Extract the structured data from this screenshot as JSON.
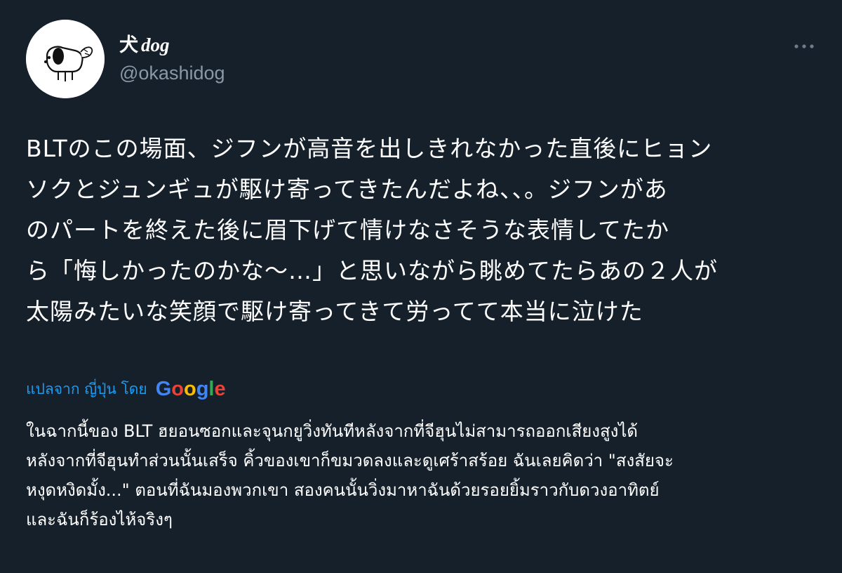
{
  "author": {
    "display_name": {
      "kanji": "犬",
      "latin": "dog"
    },
    "handle": "@okashidog",
    "avatar_icon": "dog-drawing-icon"
  },
  "more_icon": "more-horizontal-icon",
  "tweet": {
    "lines": [
      "BLTのこの場面、ジフンが高音を出しきれなかった直後にヒョン",
      "ソクとジュンギュが駆け寄ってきたんだよね、、。ジフンがあ",
      "のパートを終えた後に眉下げて情けなさそうな表情してたか",
      "ら「悔しかったのかな〜…」と思いながら眺めてたらあの２人が",
      "太陽みたいな笑顔で駆け寄ってきて労ってて本当に泣けた"
    ]
  },
  "translation": {
    "label": "แปลจาก ญี่ปุ่น โดย",
    "provider": "Google",
    "provider_letters": [
      {
        "char": "G",
        "color": "#4285f4"
      },
      {
        "char": "o",
        "color": "#ea4335"
      },
      {
        "char": "o",
        "color": "#fbbc05"
      },
      {
        "char": "g",
        "color": "#4285f4"
      },
      {
        "char": "l",
        "color": "#34a853"
      },
      {
        "char": "e",
        "color": "#ea4335"
      }
    ],
    "lines": [
      "ในฉากนี้ของ BLT ฮยอนซอกและจุนกยูวิ่งทันทีหลังจากที่จีฮุนไม่สามารถออกเสียงสูงได้",
      "หลังจากที่จีฮุนทำส่วนนั้นเสร็จ คิ้วของเขาก็ขมวดลงและดูเศร้าสร้อย ฉันเลยคิดว่า \"สงสัยจะ",
      "หงุดหงิดมั้ง...\" ตอนที่ฉันมองพวกเขา สองคนนั้นวิ่งมาหาฉันด้วยรอยยิ้มราวกับดวงอาทิตย์",
      "และฉันก็ร้องไห้จริงๆ"
    ]
  },
  "colors": {
    "background": "#15202b",
    "text_primary": "#ffffff",
    "text_secondary": "#8b98a5",
    "link": "#1d9bf0"
  }
}
